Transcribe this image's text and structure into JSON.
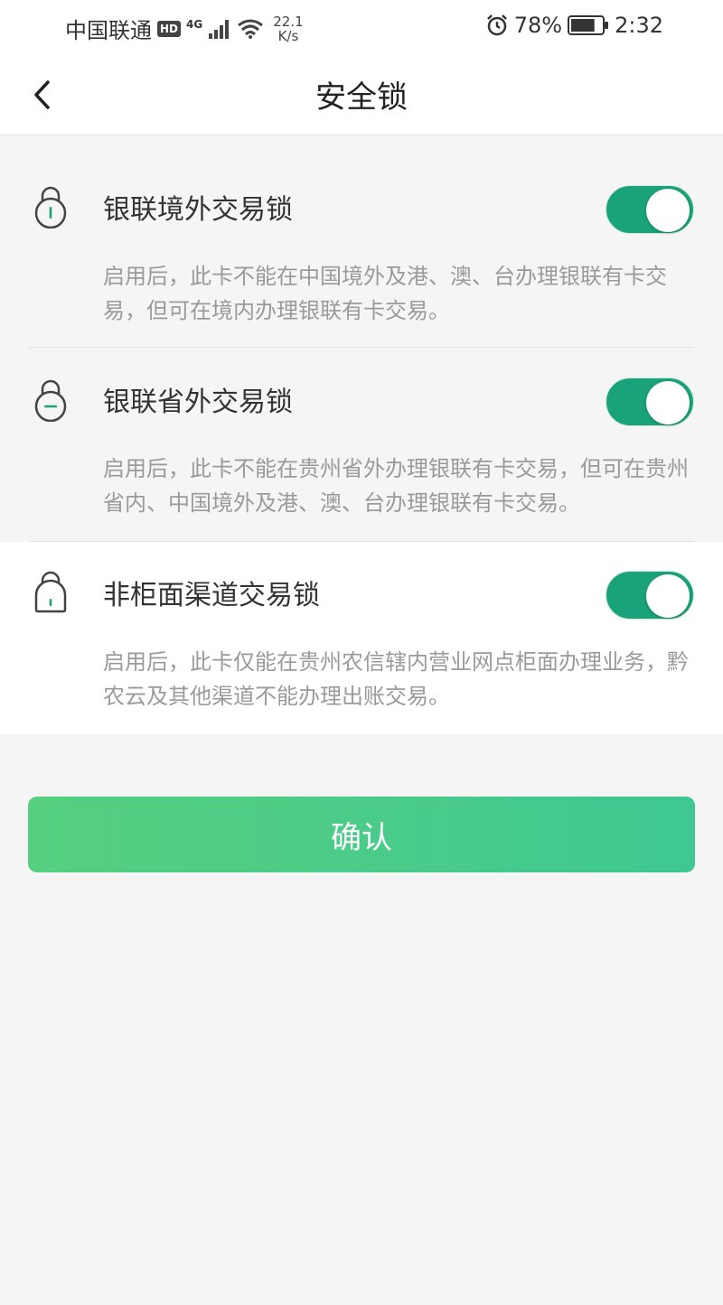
{
  "status_bar": {
    "carrier": "中国联通",
    "hd": "HD",
    "network": "4G",
    "speed_value": "22.1",
    "speed_unit": "K/s",
    "battery_percent": "78%",
    "battery_level": 0.78,
    "time": "2:32",
    "icons": [
      "signal-icon",
      "wifi-icon",
      "alarm-icon",
      "battery-icon"
    ]
  },
  "nav": {
    "title": "安全锁",
    "back_icon": "chevron-left-icon"
  },
  "locks": [
    {
      "title": "银联境外交易锁",
      "description": "启用后，此卡不能在中国境外及港、澳、台办理银联有卡交易，但可在境内办理银联有卡交易。",
      "enabled": true
    },
    {
      "title": "银联省外交易锁",
      "description": "启用后，此卡不能在贵州省外办理银联有卡交易，但可在贵州省内、中国境外及港、澳、台办理银联有卡交易。",
      "enabled": true
    },
    {
      "title": "非柜面渠道交易锁",
      "description": "启用后，此卡仅能在贵州农信辖内营业网点柜面办理业务，黔农云及其他渠道不能办理出账交易。",
      "enabled": true
    }
  ],
  "confirm": {
    "label": "确认"
  },
  "colors": {
    "accent": "#1aa37a",
    "button_start": "#56cf7f",
    "button_end": "#3fc892",
    "icon_accent": "#1aa37a"
  }
}
